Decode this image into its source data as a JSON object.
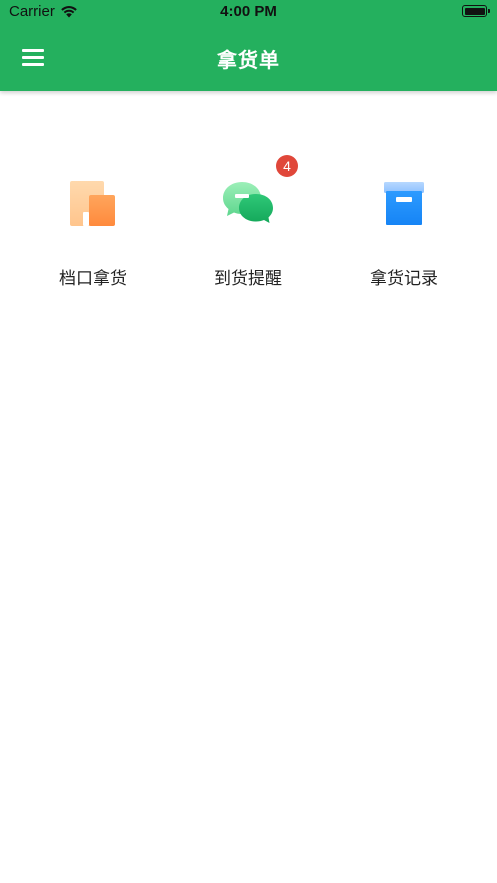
{
  "status_bar": {
    "carrier": "Carrier",
    "time": "4:00 PM",
    "wifi_icon": "wifi-icon",
    "battery_icon": "battery-icon"
  },
  "header": {
    "title": "拿货单",
    "menu_icon": "hamburger-menu-icon",
    "background_color": "#24b05e"
  },
  "grid": {
    "items": [
      {
        "label": "档口拿货",
        "icon": "store-icon",
        "color": "#ff8a3d"
      },
      {
        "label": "到货提醒",
        "icon": "chat-bubbles-icon",
        "color": "#1fb866",
        "badge": "4"
      },
      {
        "label": "拿货记录",
        "icon": "archive-box-icon",
        "color": "#1e90ff"
      }
    ]
  },
  "badge_color": "#e0473a"
}
